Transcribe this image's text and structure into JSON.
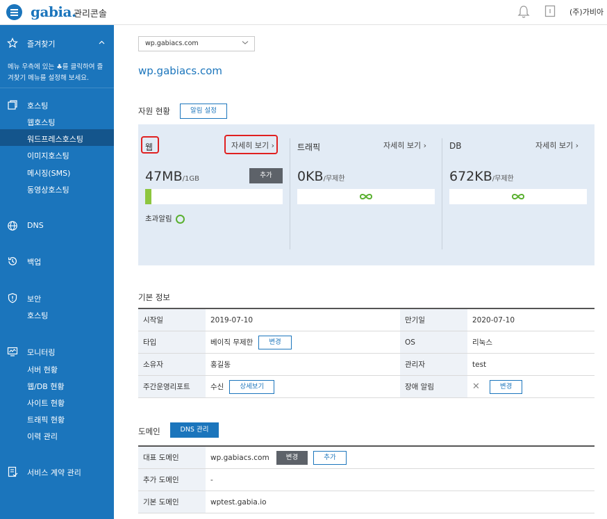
{
  "topbar": {
    "logo": "gabia.",
    "console": "관리콘솔",
    "company": "(주)가비아",
    "icons": [
      "menu-icon",
      "bell-icon",
      "document-icon"
    ]
  },
  "sidebar": {
    "favorites": {
      "label": "즐겨찾기",
      "note": "메뉴 우측에 있는 ♣를 클릭하여 즐겨찾기 메뉴를 설정해 보세요."
    },
    "hosting": {
      "label": "호스팅",
      "items": [
        "웹호스팅",
        "워드프레스호스팅",
        "이미지호스팅",
        "메시징(SMS)",
        "동영상호스팅"
      ],
      "active": "워드프레스호스팅"
    },
    "dns": {
      "label": "DNS"
    },
    "backup": {
      "label": "백업"
    },
    "security": {
      "label": "보안",
      "items": [
        "호스팅"
      ]
    },
    "monitoring": {
      "label": "모니터링",
      "items": [
        "서버 현황",
        "웹/DB 현황",
        "사이트 현황",
        "트래픽 현황",
        "이력 관리"
      ]
    },
    "contract": {
      "label": "서비스 계약 관리"
    }
  },
  "main": {
    "selector": {
      "value": "wp.gabiacs.com"
    },
    "domain_title": "wp.gabiacs.com",
    "resources": {
      "title": "자원 현황",
      "alert_btn": "알림 설정",
      "web": {
        "title": "웹",
        "detail": "자세히 보기",
        "value": "47MB",
        "unit": "/1GB",
        "add_btn": "추가",
        "usage_percent": 4.6,
        "over_alert": "초과알림"
      },
      "traffic": {
        "title": "트래픽",
        "detail": "자세히 보기",
        "value": "0KB",
        "unit": "/무제한"
      },
      "db": {
        "title": "DB",
        "detail": "자세히 보기",
        "value": "672KB",
        "unit": "/무제한"
      }
    },
    "basic": {
      "title": "기본 정보",
      "rows": [
        {
          "k1": "시작일",
          "v1": "2019-07-10",
          "k2": "만기일",
          "v2": "2020-07-10"
        },
        {
          "k1": "타입",
          "v1": "베이직 무제한",
          "btn1": "변경",
          "k2": "OS",
          "v2": "리눅스"
        },
        {
          "k1": "소유자",
          "v1": "홍길동",
          "k2": "관리자",
          "v2": "test"
        },
        {
          "k1": "주간운영리포트",
          "v1": "수신",
          "btn1": "상세보기",
          "k2": "장애 알림",
          "v2": "✕",
          "btn2": "변경"
        }
      ]
    },
    "domain": {
      "title": "도메인",
      "dns_btn": "DNS 관리",
      "rows": [
        {
          "k": "대표 도메인",
          "v": "wp.gabiacs.com",
          "btn_change": "변경",
          "btn_add": "추가"
        },
        {
          "k": "추가 도메인",
          "v": "-"
        },
        {
          "k": "기본 도메인",
          "v": "wptest.gabia.io"
        }
      ]
    }
  }
}
